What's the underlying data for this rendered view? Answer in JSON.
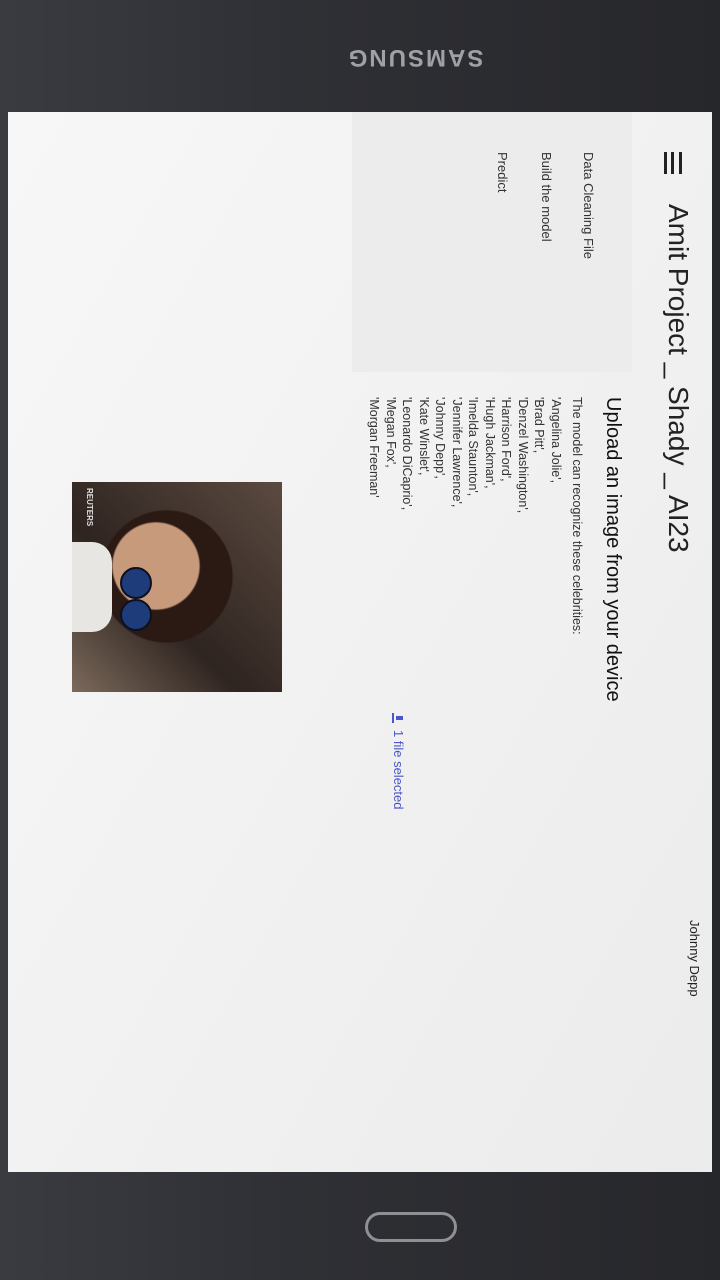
{
  "device": {
    "brand": "SAMSUNG"
  },
  "app": {
    "title": "Amit Project _ Shady _ AI23"
  },
  "sidebar": {
    "items": [
      {
        "label": "Data Cleaning File"
      },
      {
        "label": "Build the model"
      },
      {
        "label": "Predict"
      }
    ]
  },
  "main": {
    "heading": "Upload an image from your device",
    "intro": "The model can recognize these celebrities:",
    "celebrities": [
      "'Angelina Jolie',",
      "'Brad Pitt',",
      "'Denzel Washington',",
      "'Harrison Ford',",
      "'Hugh Jackman',",
      "'Imelda Staunton',",
      "'Jennifer Lawrence',",
      "'Johnny Depp',",
      "'Kate Winslet',",
      "'Leonardo DiCaprio',",
      "'Megan Fox',",
      "'Morgan Freeman'"
    ],
    "photo_watermark": "REUTERS",
    "upload_status": "1 file selected",
    "prediction": "Johnny Depp"
  }
}
